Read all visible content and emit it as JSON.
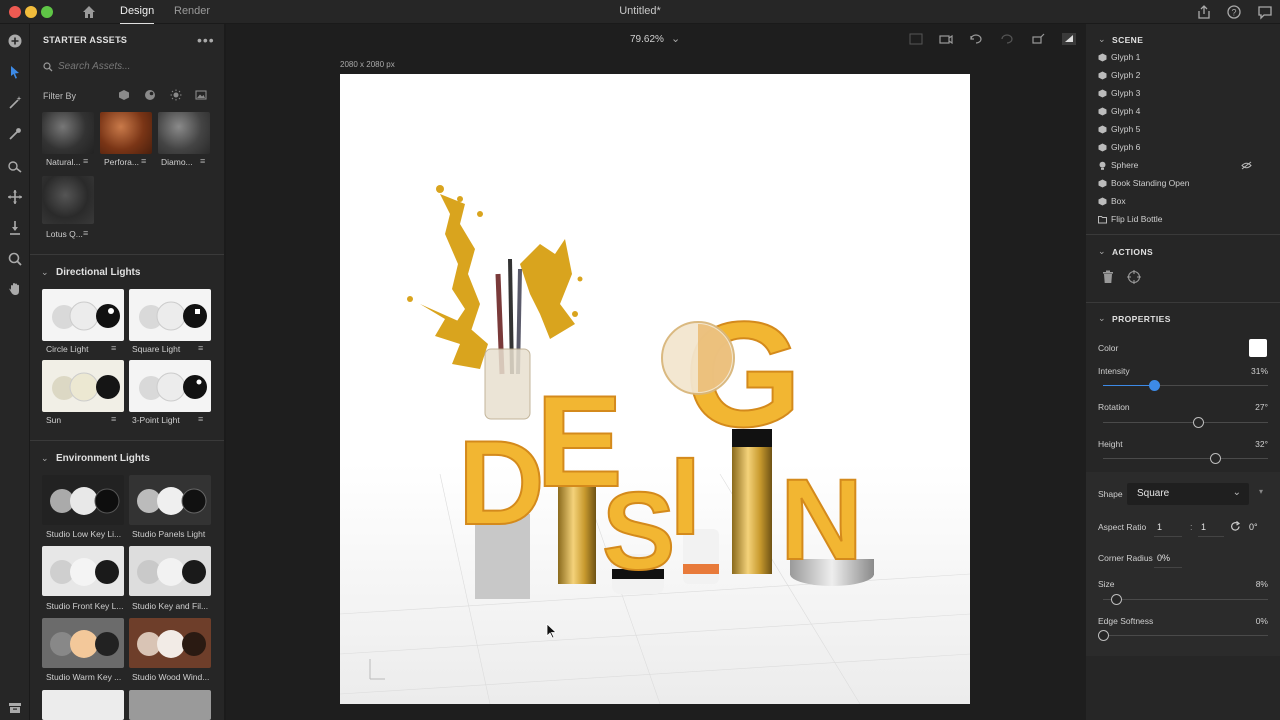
{
  "titlebar": {
    "tabs": [
      "Design",
      "Render"
    ],
    "document_title": "Untitled*"
  },
  "assets": {
    "header": "STARTER ASSETS",
    "search_placeholder": "Search Assets...",
    "filter_label": "Filter By",
    "materials": [
      {
        "label": "Natural..."
      },
      {
        "label": "Perfora..."
      },
      {
        "label": "Diamo..."
      },
      {
        "label": "Lotus Q..."
      }
    ],
    "directional_title": "Directional Lights",
    "directional": [
      {
        "label": "Circle Light"
      },
      {
        "label": "Square Light"
      },
      {
        "label": "Sun"
      },
      {
        "label": "3-Point Light"
      }
    ],
    "environment_title": "Environment Lights",
    "environment": [
      {
        "label": "Studio Low Key Li..."
      },
      {
        "label": "Studio Panels Light"
      },
      {
        "label": "Studio Front Key L..."
      },
      {
        "label": "Studio Key and Fil..."
      },
      {
        "label": "Studio Warm Key ..."
      },
      {
        "label": "Studio Wood Wind..."
      }
    ]
  },
  "canvas": {
    "zoom": "79.62%",
    "size_label": "2080 x 2080 px",
    "artwork_letters": {
      "d": "D",
      "e": "E",
      "s": "S",
      "i": "I",
      "g": "G",
      "n": "N"
    }
  },
  "panel": {
    "scene_title": "SCENE",
    "scene_items": [
      {
        "label": "Glyph 1",
        "icon": "model-icon"
      },
      {
        "label": "Glyph 2",
        "icon": "model-icon"
      },
      {
        "label": "Glyph 3",
        "icon": "model-icon"
      },
      {
        "label": "Glyph 4",
        "icon": "model-icon"
      },
      {
        "label": "Glyph 5",
        "icon": "model-icon"
      },
      {
        "label": "Glyph 6",
        "icon": "model-icon"
      },
      {
        "label": "Sphere",
        "icon": "light-icon"
      },
      {
        "label": "Book Standing Open",
        "icon": "model-icon"
      },
      {
        "label": "Box",
        "icon": "model-icon"
      },
      {
        "label": "Flip Lid Bottle",
        "icon": "folder-icon"
      }
    ],
    "actions_title": "ACTIONS",
    "properties_title": "PROPERTIES",
    "color_label": "Color",
    "intensity_label": "Intensity",
    "intensity_value": "31%",
    "intensity_fraction": 0.31,
    "rotation_label": "Rotation",
    "rotation_value": "27°",
    "rotation_fraction": 0.58,
    "height_label": "Height",
    "height_value": "32°",
    "height_fraction": 0.68,
    "shape_label": "Shape",
    "shape_value": "Square",
    "aspect_label": "Aspect Ratio",
    "aspect_w": "1",
    "aspect_sep": ":",
    "aspect_h": "1",
    "aspect_rot": "0°",
    "corner_label": "Corner Radius",
    "corner_value": "0%",
    "size_label": "Size",
    "size_value": "8%",
    "size_fraction": 0.08,
    "edge_label": "Edge Softness",
    "edge_value": "0%",
    "edge_fraction": 0.0
  },
  "colors": {
    "accent": "#3d8ae6",
    "letter_yellow": "#f2b632"
  }
}
